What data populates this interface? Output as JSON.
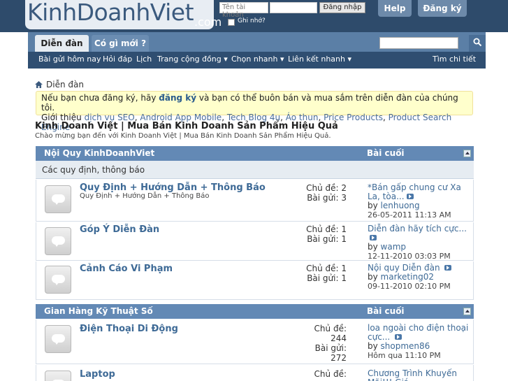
{
  "header": {
    "logo_text": "KinhDoanhViet",
    "logo_com": ".com",
    "username_placeholder": "Tên tài khoản",
    "login_button": "Đăng nhập",
    "remember_label": "Ghi nhớ?",
    "help_button": "Help",
    "register_button": "Đăng ký"
  },
  "nav": {
    "tabs": [
      {
        "label": "Diễn đàn",
        "active": true
      },
      {
        "label": "Có gì mới ?",
        "active": false
      }
    ],
    "subnav": [
      "Bài gửi hôm nay",
      "Hỏi đáp",
      "Lịch",
      "Trang cộng đồng",
      "Chọn nhanh",
      "Liên kết nhanh"
    ],
    "advanced_search": "Tìm chi tiết",
    "search_icon": "magnifier-icon"
  },
  "breadcrumb": {
    "label": "Diễn đàn"
  },
  "notice": {
    "line1_pre": "Nếu bạn chưa đăng ký, hãy ",
    "register_link": "đăng ký",
    "line1_post": " và bạn có thể buôn bán và mua sắm trên diễn đàn của chúng tôi.",
    "line2_pre": "Giới thiệu ",
    "links": [
      "dịch vụ SEO",
      "Android App Mobile",
      "Tech Blog 4u",
      "Áo thun",
      "Price Products",
      "Product Search Engine"
    ]
  },
  "site": {
    "title": "Kinh Doanh Việt | Mua Bán Kinh Doanh Sản Phẩm Hiệu Quả",
    "description": "Chào mừng bạn đến với Kinh Doanh Việt | Mua Bán Kinh Doanh Sản Phẩm Hiệu Quả."
  },
  "categories": [
    {
      "title": "Nội Quy KinhDoanhViet",
      "last_label": "Bài cuối",
      "description": "Các quy định, thông báo",
      "forums": [
        {
          "title": "Quy Định + Hướng Dẫn + Thông Báo",
          "subtitle": "Quy Định + Hướng Dẫn + Thông Báo",
          "threads_label": "Chủ đề:",
          "threads": "2",
          "posts_label": "Bài gửi:",
          "posts": "3",
          "last_title": "*Bán gấp chung cư Xa La, tòa...",
          "last_by": "by",
          "last_user": "lenhuong",
          "last_date": "26-05-2011",
          "last_time": "11:13 AM"
        },
        {
          "title": "Góp Ý Diễn Đàn",
          "subtitle": "",
          "threads_label": "Chủ đề:",
          "threads": "1",
          "posts_label": "Bài gửi:",
          "posts": "1",
          "last_title": "Diễn đàn hãy tích cực...",
          "last_by": "by",
          "last_user": "wamp",
          "last_date": "12-11-2010",
          "last_time": "03:03 PM"
        },
        {
          "title": "Cảnh Cáo Vi Phạm",
          "subtitle": "",
          "threads_label": "Chủ đề:",
          "threads": "1",
          "posts_label": "Bài gửi:",
          "posts": "1",
          "last_title": "Nội quy Diễn đàn",
          "last_by": "by",
          "last_user": "marketing02",
          "last_date": "09-11-2010",
          "last_time": "02:10 PM"
        }
      ]
    },
    {
      "title": "Gian Hàng Kỹ Thuật Số",
      "last_label": "Bài cuối",
      "forums": [
        {
          "title": "Điện Thoại Di Động",
          "threads_label": "Chủ đề:",
          "threads": "244",
          "posts_label": "Bài gửi:",
          "posts": "272",
          "last_title": "loa ngoài cho điện thoại cực...",
          "last_by": "by",
          "last_user": "shopmen86",
          "last_date": "Hôm qua",
          "last_time": "11:10 PM"
        },
        {
          "title": "Laptop",
          "threads_label": "Chủ đề:",
          "threads": "",
          "last_title": "Chương Trình Khuyến Mãi!!! Giá..."
        }
      ]
    }
  ]
}
